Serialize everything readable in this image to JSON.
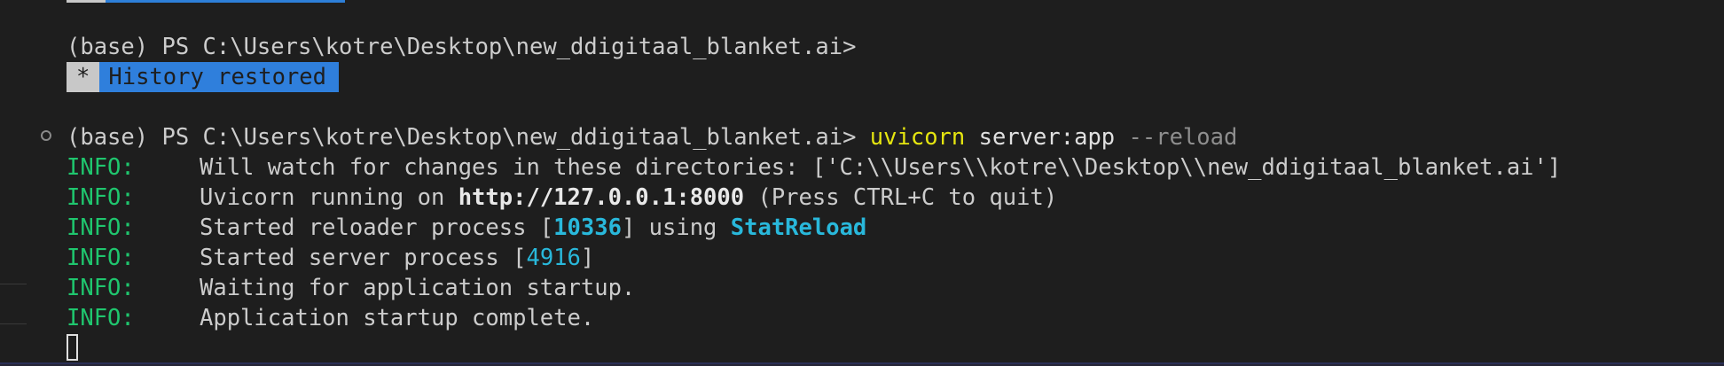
{
  "terminal": {
    "prompt_prefix": "(base) PS C:\\Users\\kotre\\Desktop\\new_ddigitaal_blanket.ai>",
    "history_star": "*",
    "history_text": "History restored",
    "command_name": "uvicorn",
    "command_arg": "server:app",
    "command_flag": "--reload",
    "log_level": "INFO:",
    "logs": {
      "line1": "Will watch for changes in these directories: ['C:\\\\Users\\\\kotre\\\\Desktop\\\\new_ddigitaal_blanket.ai']",
      "line2_pre": "Uvicorn running on ",
      "line2_url": "http://127.0.0.1:8000",
      "line2_post": " (Press CTRL+C to quit)",
      "line3_pre": "Started reloader process [",
      "line3_pid": "10336",
      "line3_mid": "] using ",
      "line3_reloader": "StatReload",
      "line4_pre": "Started server process [",
      "line4_pid": "4916",
      "line4_post": "]",
      "line5": "Waiting for application startup.",
      "line6": "Application startup complete."
    }
  },
  "colors": {
    "background": "#1e1e1e",
    "info_green": "#1fc66e",
    "command_yellow": "#e5e510",
    "number_cyan": "#29b8db",
    "badge_blue": "#2f7fdc"
  }
}
